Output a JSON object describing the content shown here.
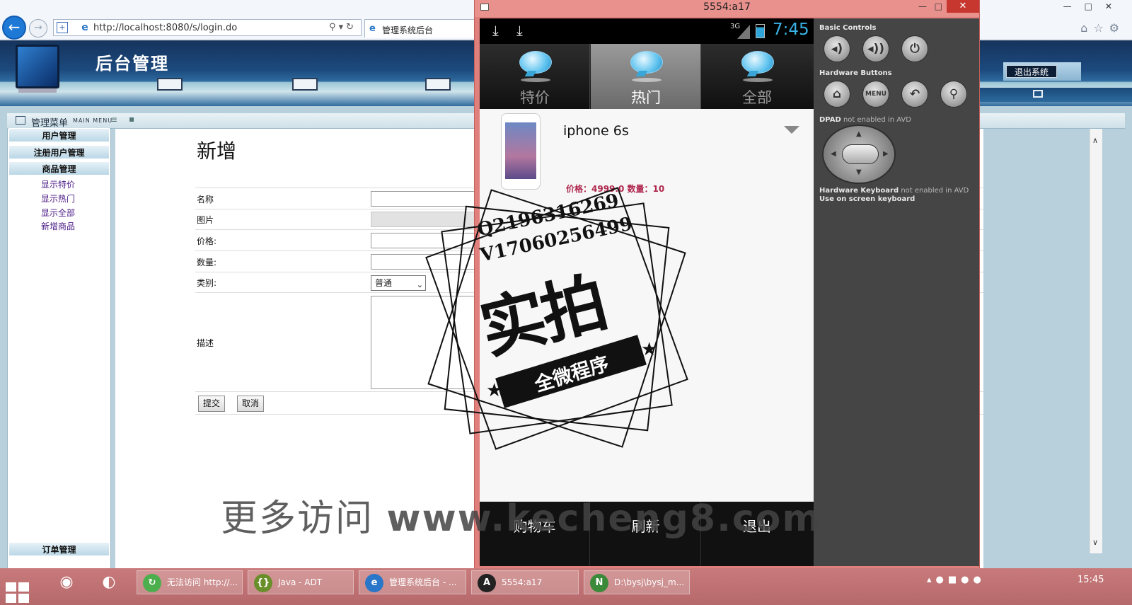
{
  "browser": {
    "url": "http://localhost:8080/s/login.do",
    "tab_title": "管理系统后台"
  },
  "admin": {
    "header_title": "后台管理",
    "logout_label": "退出系统",
    "menu_title": "管理菜单",
    "menu_subtitle": "MAIN MENU",
    "menu": {
      "user_mgmt": "用户管理",
      "registered_users": "注册用户管理",
      "goods_mgmt": "商品管理",
      "goods_links": [
        "显示特价",
        "显示热门",
        "显示全部",
        "新增商品"
      ],
      "order_mgmt": "订单管理"
    },
    "form": {
      "title": "新增",
      "labels": {
        "name": "名称",
        "image": "图片",
        "price": "价格:",
        "quantity": "数量:",
        "category": "类别:",
        "description": "描述"
      },
      "category_value": "普通",
      "submit_label": "提交",
      "cancel_label": "取消"
    }
  },
  "emulator": {
    "window_title": "5554:a17",
    "status": {
      "network": "3G",
      "time": "7:45"
    },
    "tabs": [
      {
        "label": "特价",
        "selected": false
      },
      {
        "label": "热门",
        "selected": true
      },
      {
        "label": "全部",
        "selected": false
      }
    ],
    "product": {
      "name": "iphone 6s",
      "meta": "价格：4999.0  数量：10"
    },
    "bottom_buttons": [
      "购物车",
      "刷新",
      "退出"
    ],
    "controls": {
      "basic_controls": "Basic Controls",
      "hardware_buttons": "Hardware Buttons",
      "dpad_label": "DPAD",
      "dpad_note": "not enabled in AVD",
      "keyboard_label": "Hardware Keyboard",
      "keyboard_note": "not enabled in AVD",
      "keyboard_hint": "Use on screen keyboard",
      "menu_button": "MENU"
    }
  },
  "watermark": {
    "stamp_q": "Q2196316269",
    "stamp_v": "V17060256499",
    "stamp_main": "实拍",
    "stamp_sub": "全微程序",
    "site_prefix": "更多访问",
    "site_url": "www.kecheng8.com"
  },
  "taskbar": {
    "tasks": [
      {
        "label": "无法访问 http://...",
        "icon": "browser-icon",
        "color": "#4cae4c"
      },
      {
        "label": "Java - ADT",
        "icon": "eclipse-icon",
        "color": "#6a8f2a"
      },
      {
        "label": "管理系统后台 - ...",
        "icon": "ie-icon",
        "color": "#2a76c8"
      },
      {
        "label": "5554:a17",
        "icon": "android-icon",
        "color": "#222"
      },
      {
        "label": "D:\\bysj\\bysj_m...",
        "icon": "notepad-icon",
        "color": "#3a8a3a"
      }
    ],
    "time": "15:45"
  },
  "colors": {
    "emulator_frame": "#e0807d",
    "clock": "#39b3e6",
    "product_meta": "#b0284e",
    "admin_link": "#4b1b86"
  }
}
